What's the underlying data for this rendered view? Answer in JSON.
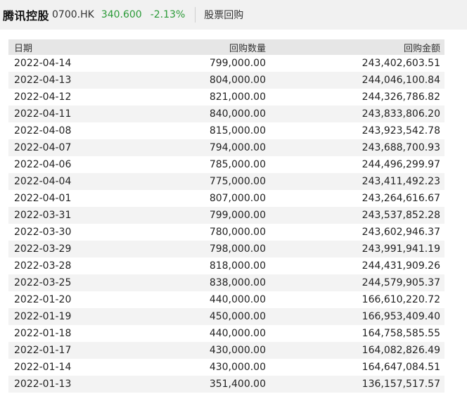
{
  "header": {
    "name": "腾讯控股",
    "code": "0700.HK",
    "price": "340.600",
    "change": "-2.13%",
    "section": "股票回购"
  },
  "table": {
    "columns": [
      "日期",
      "回购数量",
      "回购金额"
    ],
    "rows": [
      {
        "date": "2022-04-14",
        "qty": "799,000.00",
        "amount": "243,402,603.51"
      },
      {
        "date": "2022-04-13",
        "qty": "804,000.00",
        "amount": "244,046,100.84"
      },
      {
        "date": "2022-04-12",
        "qty": "821,000.00",
        "amount": "244,326,786.82"
      },
      {
        "date": "2022-04-11",
        "qty": "840,000.00",
        "amount": "243,833,806.20"
      },
      {
        "date": "2022-04-08",
        "qty": "815,000.00",
        "amount": "243,923,542.78"
      },
      {
        "date": "2022-04-07",
        "qty": "794,000.00",
        "amount": "243,688,700.93"
      },
      {
        "date": "2022-04-06",
        "qty": "785,000.00",
        "amount": "244,496,299.97"
      },
      {
        "date": "2022-04-04",
        "qty": "775,000.00",
        "amount": "243,411,492.23"
      },
      {
        "date": "2022-04-01",
        "qty": "807,000.00",
        "amount": "243,264,616.67"
      },
      {
        "date": "2022-03-31",
        "qty": "799,000.00",
        "amount": "243,537,852.28"
      },
      {
        "date": "2022-03-30",
        "qty": "780,000.00",
        "amount": "243,602,946.37"
      },
      {
        "date": "2022-03-29",
        "qty": "798,000.00",
        "amount": "243,991,941.19"
      },
      {
        "date": "2022-03-28",
        "qty": "818,000.00",
        "amount": "244,431,909.26"
      },
      {
        "date": "2022-03-25",
        "qty": "838,000.00",
        "amount": "244,579,905.37"
      },
      {
        "date": "2022-01-20",
        "qty": "440,000.00",
        "amount": "166,610,220.72"
      },
      {
        "date": "2022-01-19",
        "qty": "450,000.00",
        "amount": "166,953,409.40"
      },
      {
        "date": "2022-01-18",
        "qty": "440,000.00",
        "amount": "164,758,585.55"
      },
      {
        "date": "2022-01-17",
        "qty": "430,000.00",
        "amount": "164,082,826.49"
      },
      {
        "date": "2022-01-14",
        "qty": "430,000.00",
        "amount": "164,647,084.51"
      },
      {
        "date": "2022-01-13",
        "qty": "351,400.00",
        "amount": "136,157,517.57"
      }
    ]
  },
  "colors": {
    "price_change": "#2a9a37",
    "header_bg": "#f1f1f1",
    "table_header_bg": "#e6e6e6",
    "stripe_bg": "#f3f3f3"
  }
}
